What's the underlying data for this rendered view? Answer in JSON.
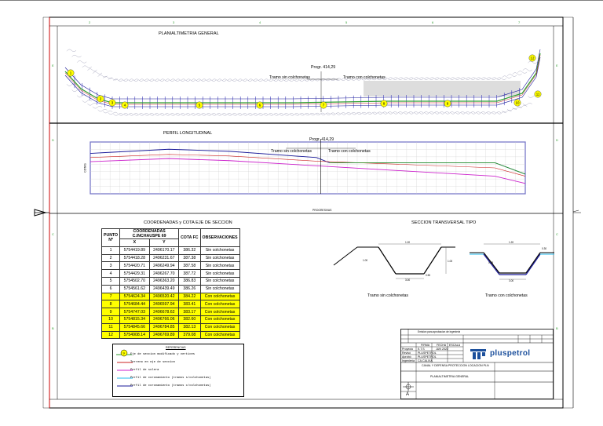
{
  "sheet": {
    "plan_title": "PLANIALTIMETRIA GENERAL",
    "profile_title": "PERFIL LONGITUDINAL",
    "coords_title": "COORDENADAS y COTA EJE DE SECCION",
    "section_title": "SECCION TRANSVERSAL TIPO",
    "progressive_label": "Progr. 414,29",
    "left_segment_label": "Tramo sin colchonetas",
    "right_segment_label": "Tramo con colchonetas",
    "section_left_caption": "Tramo sin colchonetas",
    "section_right_caption": "Tramo con colchonetas",
    "profile_x_title": "PROGRESIVAS",
    "profile_y_title": "COTAS"
  },
  "plan_markers": [
    "1",
    "2",
    "3",
    "4",
    "5",
    "6",
    "7",
    "8",
    "9",
    "10",
    "11",
    "12"
  ],
  "table": {
    "headers": {
      "punto": "PUNTO Nº",
      "coords": "COORDENADAS C.INCHAUSPE 69",
      "x": "X",
      "y": "Y",
      "cota": "COTA FC",
      "obs": "OBSERVACIONES"
    },
    "rows": [
      {
        "n": "1",
        "x": "5754419.89",
        "y": "2496170.17",
        "cota": "386.32",
        "obs": "Sin colchonetas"
      },
      {
        "n": "2",
        "x": "5754418.28",
        "y": "2496231.67",
        "cota": "387.38",
        "obs": "Sin colchonetas"
      },
      {
        "n": "3",
        "x": "5754420.71",
        "y": "2496249.94",
        "cota": "387.58",
        "obs": "Sin colchonetas"
      },
      {
        "n": "4",
        "x": "5754429.31",
        "y": "2496267.70",
        "cota": "387.72",
        "obs": "Sin colchonetas"
      },
      {
        "n": "5",
        "x": "5754502.70",
        "y": "2496363.20",
        "cota": "386.83",
        "obs": "Sin colchonetas"
      },
      {
        "n": "6",
        "x": "5754561.62",
        "y": "2496439.49",
        "cota": "386.26",
        "obs": "Sin colchonetas"
      },
      {
        "n": "7",
        "x": "5754624.34",
        "y": "2496520.42",
        "cota": "384.22",
        "obs": "Con colchonetas"
      },
      {
        "n": "8",
        "x": "5754684.44",
        "y": "2496597.94",
        "cota": "383.41",
        "obs": "Con colchonetas"
      },
      {
        "n": "9",
        "x": "5754747.03",
        "y": "2496678.62",
        "cota": "383.17",
        "obs": "Con colchonetas"
      },
      {
        "n": "10",
        "x": "5754815.34",
        "y": "2496766.06",
        "cota": "382.60",
        "obs": "Con colchonetas"
      },
      {
        "n": "11",
        "x": "5754845.66",
        "y": "2496784.85",
        "cota": "382.13",
        "obs": "Con colchonetas"
      },
      {
        "n": "12",
        "x": "5754908.14",
        "y": "2496769.89",
        "cota": "379.08",
        "obs": "Con colchonetas"
      }
    ]
  },
  "legend": {
    "title": "REFERENCIAS",
    "marker_label": "9",
    "items": [
      {
        "text": "Eje de seccion modificado y vertices",
        "color": "#2e9e2e"
      },
      {
        "text": "Terreno en eje de seccion",
        "color": "#cc2222"
      },
      {
        "text": "Perfil de solera",
        "color": "#cc22cc"
      },
      {
        "text": "Perfil de coronamiento (tramos s/colchonetas)",
        "color": "#22bbee"
      },
      {
        "text": "Perfil de coronamiento (tramos c/colchonetas)",
        "color": "#1a1a99"
      }
    ]
  },
  "title_block": {
    "company": "pluspetrol",
    "project": "CANAL Y DEFENSA PROTECCION LOCACION PLN",
    "drawing": "PLANIALTIMETRIA GENERAL",
    "rev_label": "A",
    "rows": [
      "Proyecto",
      "Revisó",
      "Aprobó",
      "Ingeniería"
    ],
    "vals": [
      "E.T.S",
      "PLUSPETROL",
      "PLUSPETROL",
      "CA.CALIXA"
    ],
    "header_cells": [
      "FIRMA",
      "FECHA",
      "ESCALA"
    ],
    "date": "JUN 2022",
    "change_note": "Emision para aprobacion de ingenieria"
  },
  "colors": {
    "frame_red": "#cc0000",
    "profile_border": "#1f1fb0",
    "solera": "#cc22cc",
    "coronamiento_sin": "#1a1a99",
    "coronamiento_con": "#2e9e2e",
    "terreno": "#cc2222",
    "highlight": "#ffff00"
  }
}
